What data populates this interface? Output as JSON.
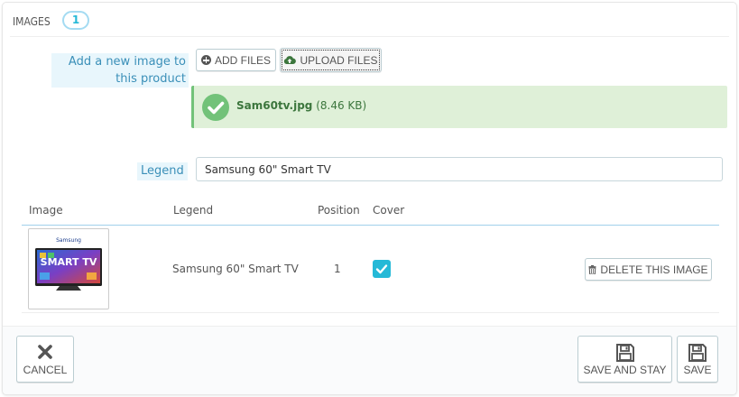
{
  "panel": {
    "title": "IMAGES",
    "count": "1"
  },
  "add_image": {
    "label": "Add a new image to this product",
    "add_files_label": "ADD FILES",
    "upload_files_label": "UPLOAD FILES"
  },
  "upload_status": {
    "file_name": "Sam60tv.jpg",
    "file_size": "(8.46 KB)"
  },
  "legend_field": {
    "label": "Legend",
    "value": "Samsung 60\" Smart TV"
  },
  "table": {
    "headers": [
      "Image",
      "Legend",
      "Position",
      "Cover"
    ],
    "rows": [
      {
        "thumb_brand": "Samsung",
        "thumb_text": "SMART TV",
        "legend": "Samsung 60\" Smart TV",
        "position": "1",
        "cover": true,
        "delete_label": "DELETE THIS IMAGE"
      }
    ]
  },
  "footer": {
    "cancel_label": "CANCEL",
    "save_and_stay_label": "SAVE AND STAY",
    "save_label": "SAVE"
  },
  "colors": {
    "accent": "#25b9d7",
    "success_bg": "#dff0d8",
    "success_icon": "#72c279",
    "hint_bg": "#e8f6fc"
  },
  "icons": {
    "add_files": "plus-circle-icon",
    "upload_files": "cloud-upload-icon",
    "success": "check-circle-icon",
    "delete": "trash-icon",
    "cancel": "close-icon",
    "save": "floppy-disk-icon"
  }
}
